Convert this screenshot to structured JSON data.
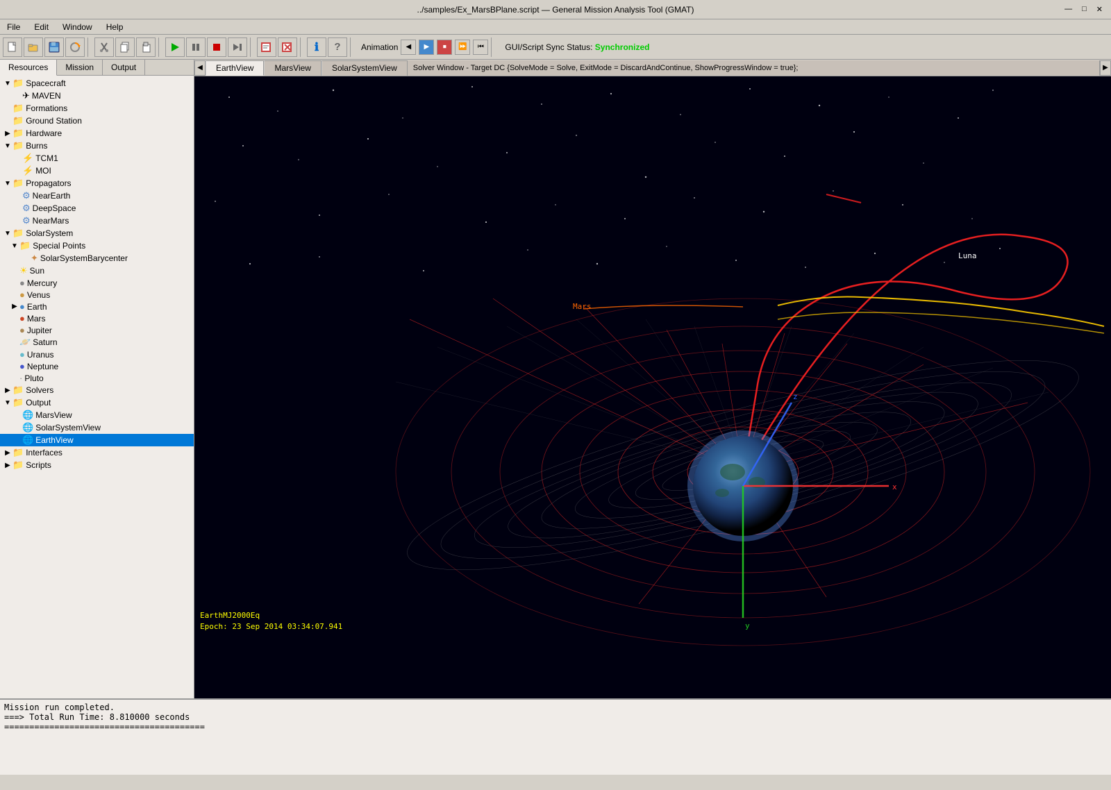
{
  "window": {
    "title": "../samples/Ex_MarsBPlane.script — General Mission Analysis Tool (GMAT)",
    "controls": [
      "—",
      "□",
      "✕"
    ]
  },
  "menu": {
    "items": [
      "File",
      "Edit",
      "Window",
      "Help"
    ]
  },
  "toolbar": {
    "buttons": [
      {
        "name": "new",
        "icon": "📄"
      },
      {
        "name": "open",
        "icon": "📂"
      },
      {
        "name": "save",
        "icon": "💾"
      },
      {
        "name": "close-script",
        "icon": "🔄"
      },
      {
        "name": "cut",
        "icon": "✂"
      },
      {
        "name": "copy",
        "icon": "📋"
      },
      {
        "name": "paste",
        "icon": "📌"
      },
      {
        "name": "run",
        "icon": "▶"
      },
      {
        "name": "pause",
        "icon": "⏸"
      },
      {
        "name": "stop",
        "icon": "⏹"
      },
      {
        "name": "step",
        "icon": "⏭"
      },
      {
        "name": "script1",
        "icon": "📝"
      },
      {
        "name": "script2",
        "icon": "❌"
      },
      {
        "name": "info",
        "icon": "ℹ"
      },
      {
        "name": "help",
        "icon": "?"
      }
    ],
    "animation_label": "Animation",
    "anim_buttons": [
      "◀",
      "▶",
      "⏹",
      "⏩",
      "⏮"
    ],
    "sync_label": "GUI/Script Sync Status:",
    "sync_value": "Synchronized"
  },
  "panel": {
    "tabs": [
      "Resources",
      "Mission",
      "Output"
    ],
    "active_tab": "Resources"
  },
  "tree": {
    "items": [
      {
        "id": "spacecraft",
        "label": "Spacecraft",
        "level": 0,
        "expanded": true,
        "icon": "folder",
        "toggle": "▼"
      },
      {
        "id": "maven",
        "label": "MAVEN",
        "level": 1,
        "icon": "rocket",
        "toggle": ""
      },
      {
        "id": "formations",
        "label": "Formations",
        "level": 0,
        "icon": "folder",
        "toggle": ""
      },
      {
        "id": "ground-station",
        "label": "Ground Station",
        "level": 0,
        "icon": "folder",
        "toggle": ""
      },
      {
        "id": "hardware",
        "label": "Hardware",
        "level": 0,
        "icon": "folder",
        "toggle": "▶"
      },
      {
        "id": "burns",
        "label": "Burns",
        "level": 0,
        "expanded": true,
        "icon": "folder",
        "toggle": "▼"
      },
      {
        "id": "tcm1",
        "label": "TCM1",
        "level": 1,
        "icon": "burn",
        "toggle": ""
      },
      {
        "id": "moi",
        "label": "MOI",
        "level": 1,
        "icon": "burn",
        "toggle": ""
      },
      {
        "id": "propagators",
        "label": "Propagators",
        "level": 0,
        "expanded": true,
        "icon": "folder",
        "toggle": "▼"
      },
      {
        "id": "nearearth",
        "label": "NearEarth",
        "level": 1,
        "icon": "prop",
        "toggle": ""
      },
      {
        "id": "deepspace",
        "label": "DeepSpace",
        "level": 1,
        "icon": "prop",
        "toggle": ""
      },
      {
        "id": "nearmars",
        "label": "NearMars",
        "level": 1,
        "icon": "prop",
        "toggle": ""
      },
      {
        "id": "solarsystem",
        "label": "SolarSystem",
        "level": 0,
        "expanded": true,
        "icon": "folder",
        "toggle": "▼"
      },
      {
        "id": "special-points",
        "label": "Special Points",
        "level": 1,
        "expanded": true,
        "icon": "folder",
        "toggle": "▼"
      },
      {
        "id": "ssbarycenter",
        "label": "SolarSystemBarycenter",
        "level": 2,
        "icon": "star",
        "toggle": ""
      },
      {
        "id": "sun",
        "label": "Sun",
        "level": 1,
        "icon": "sun",
        "toggle": ""
      },
      {
        "id": "mercury",
        "label": "Mercury",
        "level": 1,
        "icon": "planet-gray",
        "toggle": ""
      },
      {
        "id": "venus",
        "label": "Venus",
        "level": 1,
        "icon": "planet-yellow",
        "toggle": ""
      },
      {
        "id": "earth",
        "label": "Earth",
        "level": 1,
        "expanded": false,
        "icon": "planet-blue",
        "toggle": "▶"
      },
      {
        "id": "mars",
        "label": "Mars",
        "level": 1,
        "icon": "planet-red",
        "toggle": ""
      },
      {
        "id": "jupiter",
        "label": "Jupiter",
        "level": 1,
        "icon": "planet-brown",
        "toggle": ""
      },
      {
        "id": "saturn",
        "label": "Saturn",
        "level": 1,
        "icon": "planet-ring",
        "toggle": ""
      },
      {
        "id": "uranus",
        "label": "Uranus",
        "level": 1,
        "icon": "planet-cyan",
        "toggle": ""
      },
      {
        "id": "neptune",
        "label": "Neptune",
        "level": 1,
        "icon": "planet-blue2",
        "toggle": ""
      },
      {
        "id": "pluto",
        "label": "Pluto",
        "level": 1,
        "icon": "planet-small",
        "toggle": ""
      },
      {
        "id": "solvers",
        "label": "Solvers",
        "level": 0,
        "icon": "folder",
        "toggle": "▶"
      },
      {
        "id": "output",
        "label": "Output",
        "level": 0,
        "expanded": true,
        "icon": "folder",
        "toggle": "▼"
      },
      {
        "id": "marsview",
        "label": "MarsView",
        "level": 1,
        "icon": "view",
        "toggle": ""
      },
      {
        "id": "solarsystemview",
        "label": "SolarSystemView",
        "level": 1,
        "icon": "view",
        "toggle": ""
      },
      {
        "id": "earthview",
        "label": "EarthView",
        "level": 1,
        "icon": "view",
        "toggle": "",
        "selected": true
      },
      {
        "id": "interfaces",
        "label": "Interfaces",
        "level": 0,
        "icon": "folder",
        "toggle": "▶"
      },
      {
        "id": "scripts",
        "label": "Scripts",
        "level": 0,
        "icon": "folder",
        "toggle": "▶"
      }
    ]
  },
  "view_tabs": {
    "tabs": [
      "EarthView",
      "MarsView",
      "SolarSystemView"
    ],
    "active": "EarthView",
    "long_tab": "Solver Window - Target DC {SolveMode = Solve, ExitMode = DiscardAndContinue, ShowProgressWindow = true};"
  },
  "viewport": {
    "coord_label": "EarthMJ2000Eq",
    "epoch_label": "Epoch: 23 Sep 2014 03:34:07.941",
    "mars_label": "Mars",
    "luna_label": "Luna"
  },
  "status_bar": {
    "line1": "Mission run completed.",
    "line2": "===> Total Run Time: 8.810000 seconds",
    "line3": "",
    "line4": "========================================"
  },
  "icons": {
    "folder": "🗂",
    "rocket": "✈",
    "burn": "🔥",
    "prop": "⚙",
    "star": "✦",
    "sun": "☀",
    "planet": "●",
    "view": "🌐"
  }
}
